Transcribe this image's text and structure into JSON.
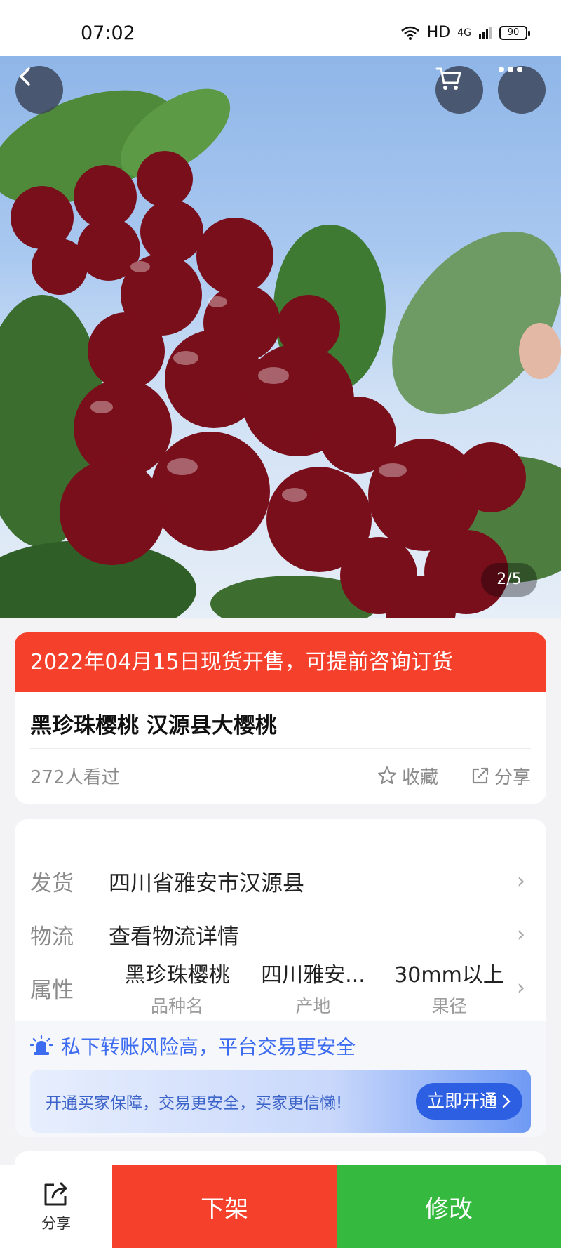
{
  "status_bar": {
    "time": "07:02",
    "hd": "HD",
    "network": "4G",
    "battery": "90"
  },
  "hero": {
    "counter": "2/5"
  },
  "product": {
    "banner": "2022年04月15日现货开售，可提前咨询订货",
    "title": "黑珍珠樱桃 汉源县大樱桃",
    "views": "272人看过",
    "favorite_label": "收藏",
    "share_label": "分享"
  },
  "details": {
    "ship_key": "发货",
    "ship_value": "四川省雅安市汉源县",
    "logistics_key": "物流",
    "logistics_value": "查看物流详情",
    "attr_key": "属性",
    "attrs": [
      {
        "value": "黑珍珠樱桃",
        "label": "品种名"
      },
      {
        "value": "四川雅安...",
        "label": "产地"
      },
      {
        "value": "30mm以上",
        "label": "果径"
      }
    ]
  },
  "safety": {
    "warning": "私下转账风险高，平台交易更安全",
    "promo_text": "开通买家保障，交易更安全，买家更信懒!",
    "promo_button": "立即开通"
  },
  "bottom_bar": {
    "share_label": "分享",
    "delist_label": "下架",
    "edit_label": "修改"
  },
  "colors": {
    "red": "#f5402c",
    "green": "#35b93f",
    "blue": "#2d5fe3"
  },
  "icons": [
    "back-icon",
    "cart-icon",
    "more-icon",
    "star-icon",
    "share-icon",
    "alarm-icon",
    "chevron-right-icon"
  ]
}
